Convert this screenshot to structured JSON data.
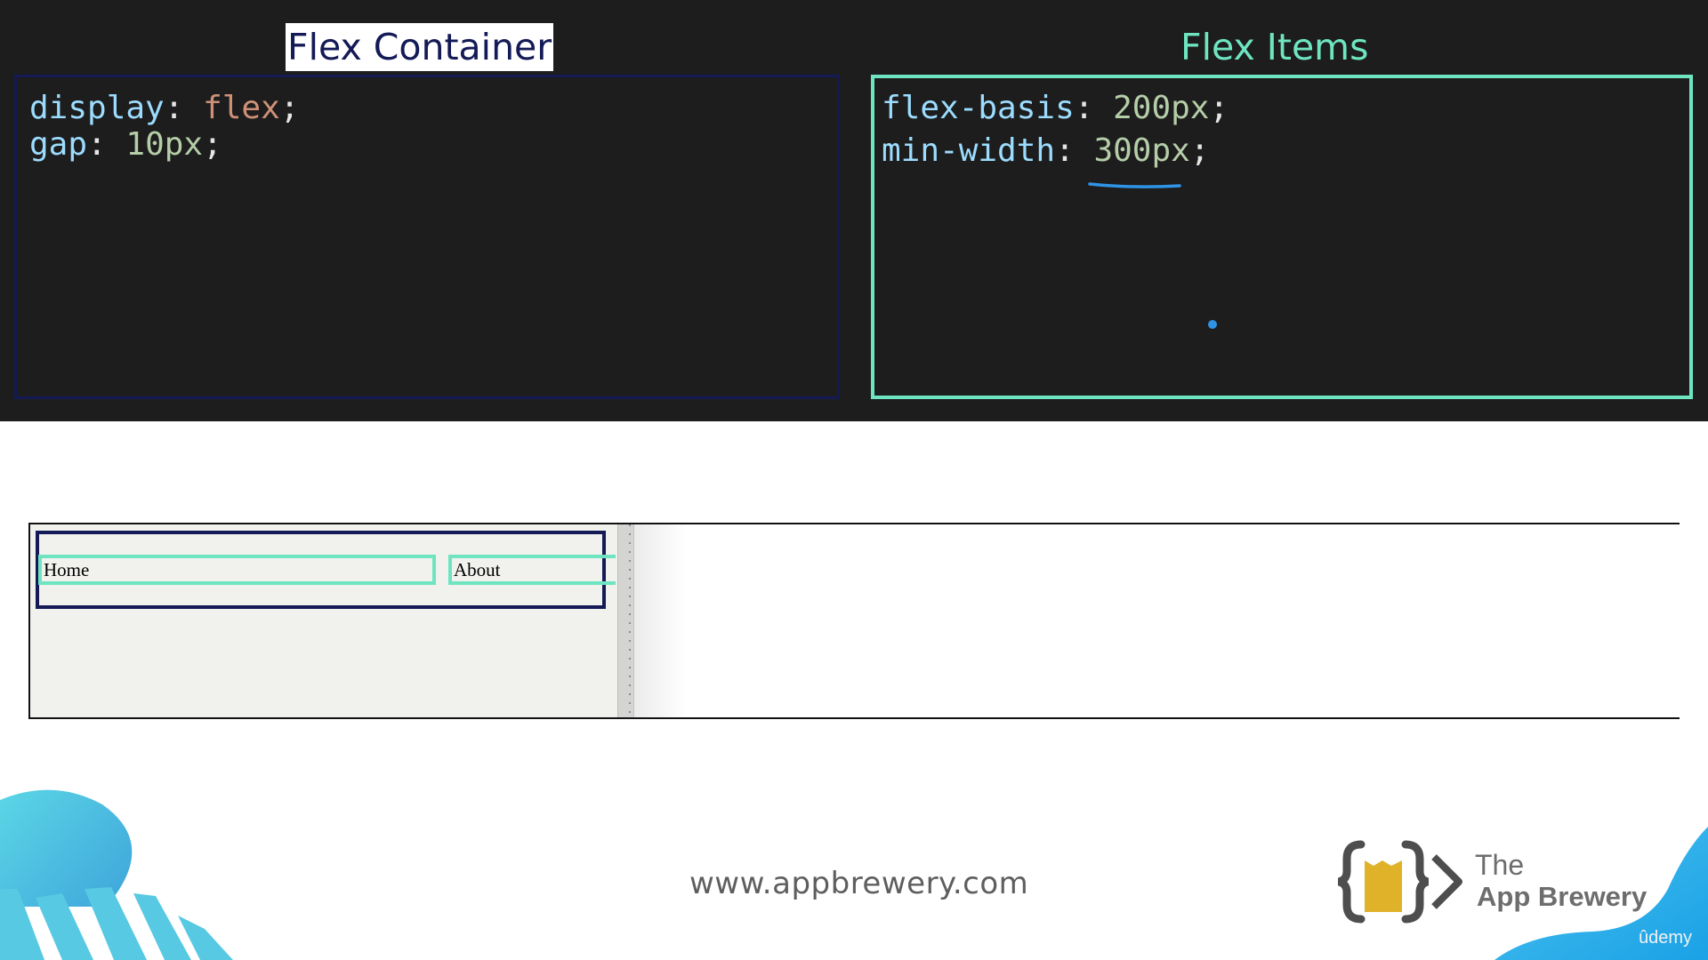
{
  "headings": {
    "container": "Flex Container",
    "items": "Flex Items"
  },
  "container_code": [
    {
      "prop": "display",
      "value": "flex"
    },
    {
      "prop": "gap",
      "value": "10px"
    }
  ],
  "items_code": [
    {
      "prop": "flex-basis",
      "value": "200px"
    },
    {
      "prop": "min-width",
      "value": "300px"
    }
  ],
  "demo": {
    "nav_items": [
      "Home",
      "About"
    ]
  },
  "footer": {
    "url": "www.appbrewery.com",
    "brand_the": "The",
    "brand_name": "App Brewery",
    "udemy": "ûdemy"
  },
  "colors": {
    "container_border": "#131a55",
    "item_border": "#6ee5c0",
    "code_background": "#1d1d1d",
    "annotation": "#2f93e6",
    "logo_yellow": "#e0b22a"
  }
}
